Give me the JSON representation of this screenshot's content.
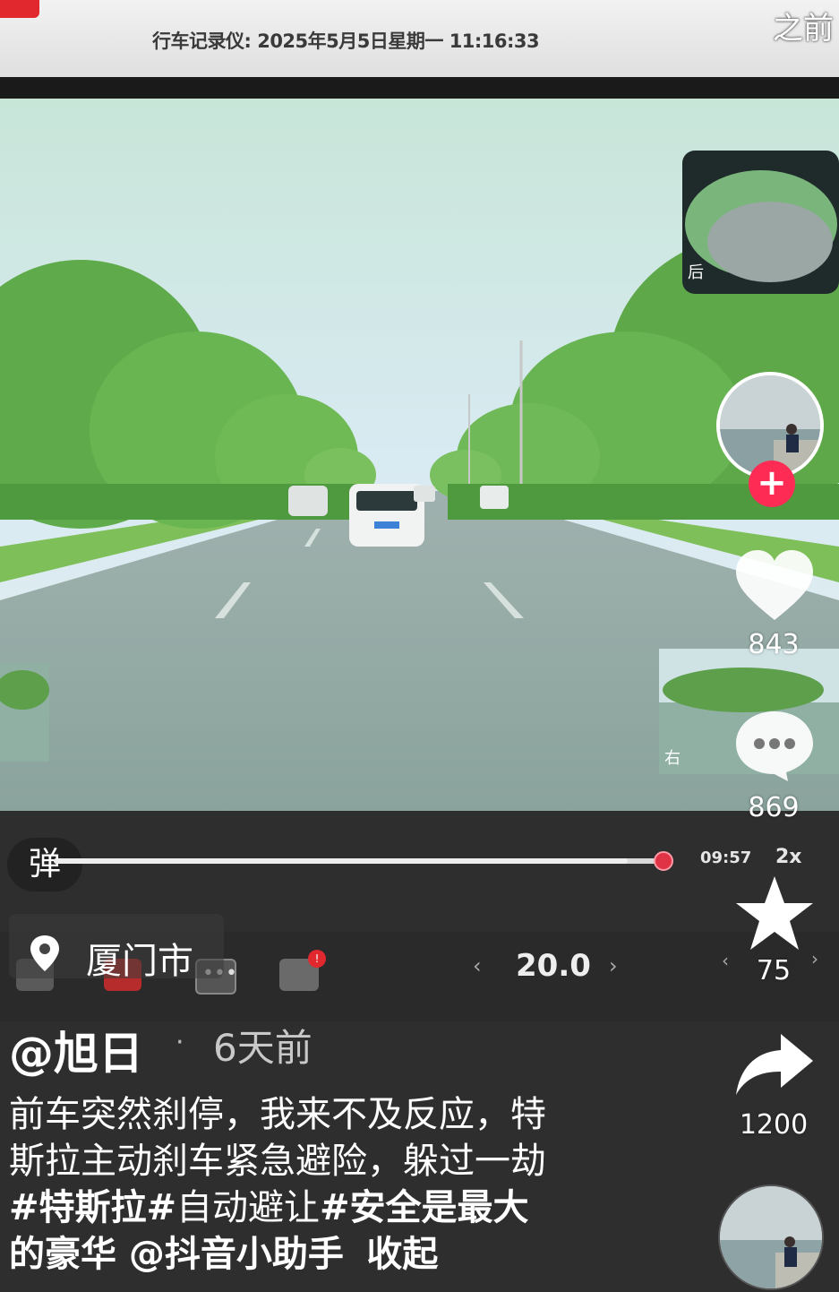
{
  "recorder": {
    "title": "行车记录仪: 2025年5月5日星期一 11:16:33"
  },
  "header": {
    "before_label": "之前"
  },
  "camera": {
    "rear_label": "后",
    "right_label": "右"
  },
  "player": {
    "danmu_label": "弹",
    "progress": 0.94,
    "time": "09:57",
    "speed": "2x",
    "zoom_value": "20.0",
    "zoom_prev": "‹",
    "zoom_next": "›",
    "vol_prev": "‹",
    "vol_next": "›",
    "camera_badge": "!"
  },
  "location": {
    "label": "厦门市"
  },
  "post": {
    "author": "@旭日",
    "separator": "·",
    "time_ago": "6天前",
    "caption_line1": "前车突然刹停，我来不及反应，特",
    "caption_line2": "斯拉主动刹车紧急避险，躲过一劫",
    "tag1": "#特斯拉",
    "tag2_prefix": "#",
    "tag2_text": "自动避让",
    "tag3": "#安全是最大",
    "line4_text": "的豪华 @抖音小助手",
    "collapse_label": "收起"
  },
  "rail": {
    "follow_label": "+",
    "likes": "843",
    "comments": "869",
    "favorites": "75",
    "shares": "1200"
  },
  "colors": {
    "accent": "#fe2c55",
    "progress_knob": "#e03346"
  }
}
